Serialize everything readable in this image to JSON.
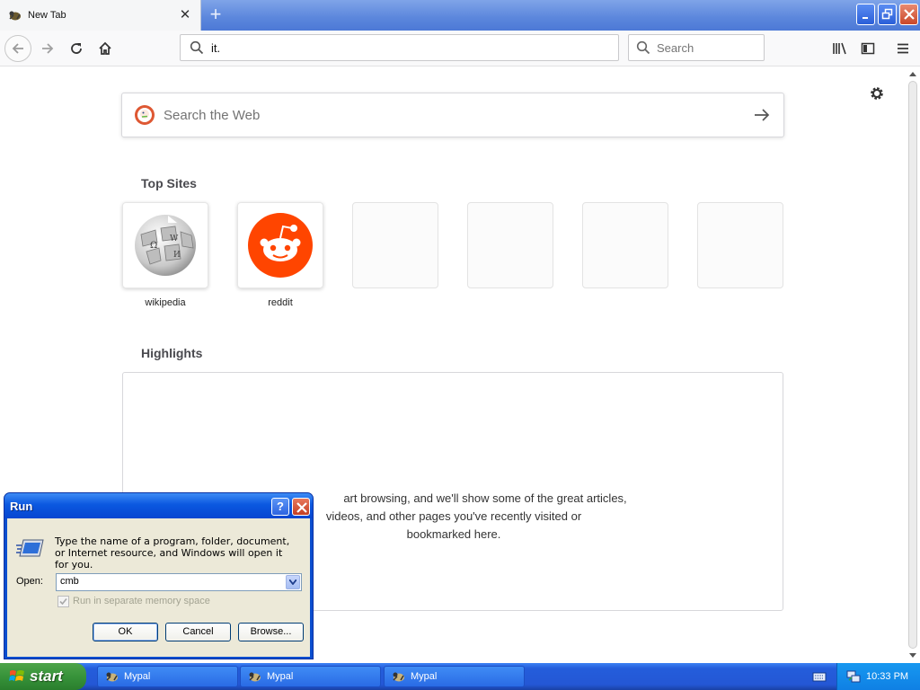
{
  "browser": {
    "tab_title": "New Tab",
    "url": "it.",
    "search_placeholder": "Search"
  },
  "newtab": {
    "web_search_placeholder": "Search the Web",
    "top_sites_title": "Top Sites",
    "top_sites": [
      {
        "label": "wikipedia",
        "icon": "wikipedia-globe-icon"
      },
      {
        "label": "reddit",
        "icon": "reddit-alien-icon"
      }
    ],
    "highlights_title": "Highlights",
    "highlights_message": [
      "art browsing, and we'll show some of the great articles,",
      "videos, and other pages you've recently visited or",
      "bookmarked here."
    ]
  },
  "run_dialog": {
    "title": "Run",
    "description": "Type the name of a program, folder, document, or Internet resource, and Windows will open it for you.",
    "open_label": "Open:",
    "open_value": "cmb",
    "checkbox_label": "Run in separate memory space",
    "ok_label": "OK",
    "cancel_label": "Cancel",
    "browse_label": "Browse..."
  },
  "taskbar": {
    "start_label": "start",
    "tasks": [
      "Mypal",
      "Mypal",
      "Mypal"
    ],
    "clock": "10:33 PM"
  },
  "colors": {
    "reddit": "#ff4500",
    "xp_blue": "#245ddb",
    "start_green": "#37933a"
  }
}
